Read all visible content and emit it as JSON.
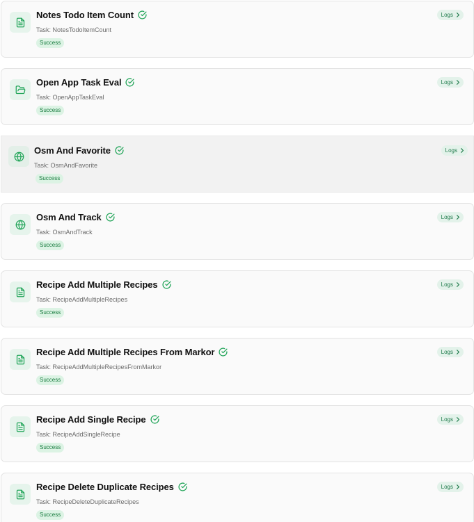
{
  "colors": {
    "accent_green": "#22a559",
    "badge_text": "#157a3c",
    "badge_bg": "#dcf3e4",
    "card_bg": "#fafafa"
  },
  "cards": [
    {
      "title": "Notes Todo Item Count",
      "task": "Task: NotesTodoItemCount",
      "status": "Success",
      "logs_label": "Logs",
      "icon": "file-text-icon"
    },
    {
      "title": "Open App Task Eval",
      "task": "Task: OpenAppTaskEval",
      "status": "Success",
      "logs_label": "Logs",
      "icon": "folder-open-icon"
    },
    {
      "title": "Osm And Favorite",
      "task": "Task: OsmAndFavorite",
      "status": "Success",
      "logs_label": "Logs",
      "icon": "globe-icon"
    },
    {
      "title": "Osm And Track",
      "task": "Task: OsmAndTrack",
      "status": "Success",
      "logs_label": "Logs",
      "icon": "globe-icon"
    },
    {
      "title": "Recipe Add Multiple Recipes",
      "task": "Task: RecipeAddMultipleRecipes",
      "status": "Success",
      "logs_label": "Logs",
      "icon": "file-text-icon"
    },
    {
      "title": "Recipe Add Multiple Recipes From Markor",
      "task": "Task: RecipeAddMultipleRecipesFromMarkor",
      "status": "Success",
      "logs_label": "Logs",
      "icon": "file-text-icon"
    },
    {
      "title": "Recipe Add Single Recipe",
      "task": "Task: RecipeAddSingleRecipe",
      "status": "Success",
      "logs_label": "Logs",
      "icon": "file-text-icon"
    },
    {
      "title": "Recipe Delete Duplicate Recipes",
      "task": "Task: RecipeDeleteDuplicateRecipes",
      "status": "Success",
      "logs_label": "Logs",
      "icon": "file-text-icon"
    }
  ]
}
